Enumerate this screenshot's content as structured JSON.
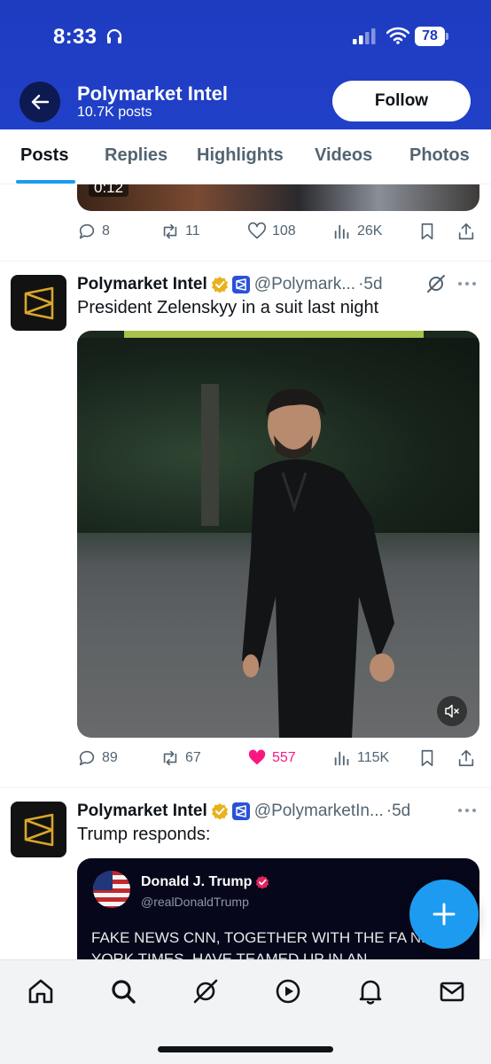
{
  "status_bar": {
    "time": "8:33",
    "battery": "78"
  },
  "header": {
    "profile_name": "Polymarket Intel",
    "posts_count": "10.7K posts",
    "follow_label": "Follow",
    "background_color": "#2140c8"
  },
  "tabs": [
    {
      "label": "Posts",
      "active": true
    },
    {
      "label": "Replies",
      "active": false
    },
    {
      "label": "Highlights",
      "active": false
    },
    {
      "label": "Videos",
      "active": false
    },
    {
      "label": "Photos",
      "active": false
    }
  ],
  "previous_post": {
    "video_duration": "0:12",
    "replies": "8",
    "reposts": "11",
    "likes": "108",
    "views": "26K"
  },
  "post1": {
    "author": "Polymarket Intel",
    "handle": "@Polymark...",
    "separator": "·",
    "time": "5d",
    "text": "President Zelenskyy in a suit last night",
    "replies": "89",
    "reposts": "67",
    "likes": "557",
    "liked": true,
    "views": "115K"
  },
  "post2": {
    "author": "Polymarket Intel",
    "handle": "@PolymarketIn...",
    "separator": "·",
    "time": "5d",
    "text": "Trump responds:",
    "quote": {
      "author": "Donald J. Trump",
      "handle": "@realDonaldTrump",
      "text": "FAKE NEWS CNN, TOGETHER WITH THE FA NEW YORK TIMES, HAVE TEAMED UP IN AN"
    }
  },
  "colors": {
    "accent": "#1d9bf0",
    "like": "#f91880",
    "verified_gold": "#e8b21e",
    "affiliate_blue": "#2a52d8"
  },
  "bottom_nav": [
    "home-icon",
    "search-icon",
    "grok-icon",
    "video-icon",
    "notifications-icon",
    "messages-icon"
  ]
}
